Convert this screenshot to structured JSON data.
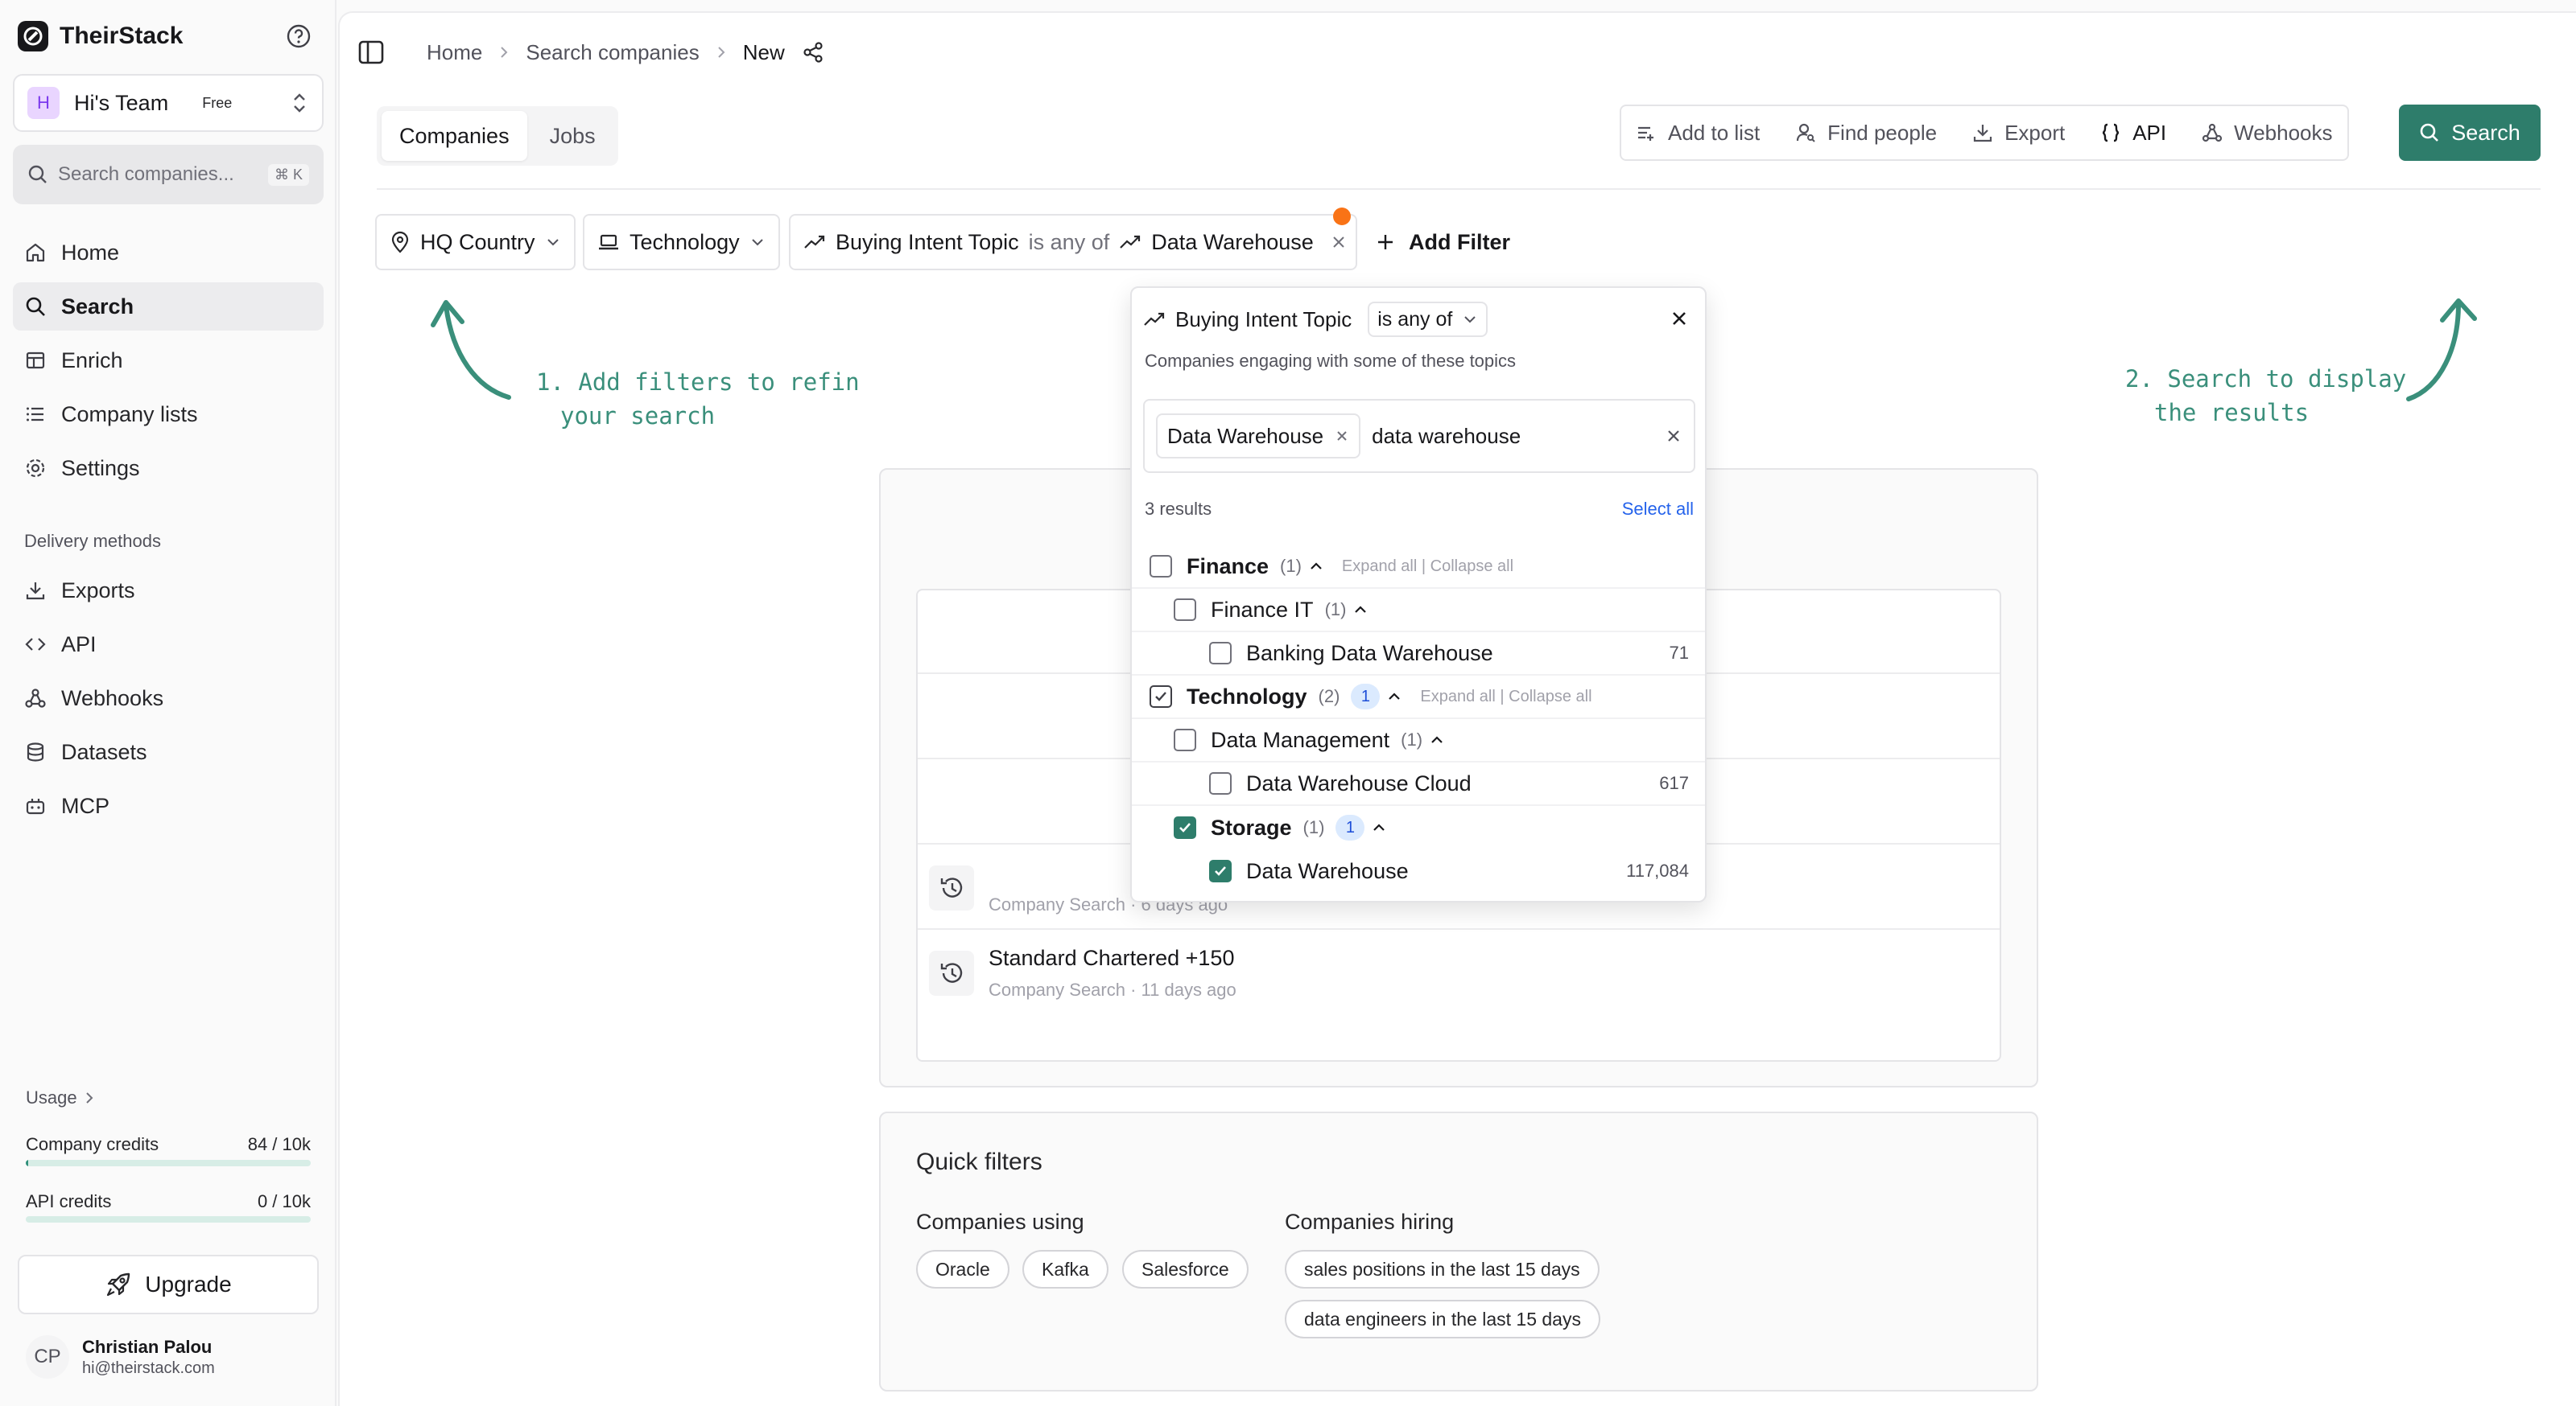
{
  "app": {
    "name": "TheirStack"
  },
  "team": {
    "avatar": "H",
    "name": "Hi's Team",
    "plan": "Free"
  },
  "sidebar": {
    "search_placeholder": "Search companies...",
    "search_shortcut": "⌘ K",
    "nav": [
      {
        "label": "Home",
        "icon": "home-icon"
      },
      {
        "label": "Search",
        "icon": "search-icon",
        "active": true
      },
      {
        "label": "Enrich",
        "icon": "enrich-icon"
      },
      {
        "label": "Company lists",
        "icon": "list-icon"
      },
      {
        "label": "Settings",
        "icon": "gear-icon"
      }
    ],
    "delivery_label": "Delivery methods",
    "delivery": [
      {
        "label": "Exports",
        "icon": "download-icon"
      },
      {
        "label": "API",
        "icon": "code-icon"
      },
      {
        "label": "Webhooks",
        "icon": "webhook-icon"
      },
      {
        "label": "Datasets",
        "icon": "database-icon"
      },
      {
        "label": "MCP",
        "icon": "mcp-icon"
      }
    ],
    "usage_label": "Usage",
    "credits": [
      {
        "label": "Company credits",
        "value": "84 / 10k",
        "fraction": 0.0084
      },
      {
        "label": "API credits",
        "value": "0 / 10k",
        "fraction": 0.0
      }
    ],
    "upgrade_label": "Upgrade",
    "user": {
      "initials": "CP",
      "name": "Christian Palou",
      "email": "hi@theirstack.com"
    }
  },
  "breadcrumb": {
    "items": [
      "Home",
      "Search companies"
    ],
    "current": "New"
  },
  "tabs": [
    {
      "label": "Companies",
      "active": true
    },
    {
      "label": "Jobs"
    }
  ],
  "actions": {
    "add_to_list": "Add to list",
    "find_people": "Find people",
    "export": "Export",
    "api": "API",
    "webhooks": "Webhooks",
    "search": "Search"
  },
  "filters": {
    "hq_country": "HQ Country",
    "technology": "Technology",
    "buying_intent": {
      "field": "Buying Intent Topic",
      "operator": "is any of",
      "value": "Data Warehouse"
    },
    "add_filter": "Add Filter"
  },
  "hints": {
    "left": [
      "1. Add filters to refin",
      "your search"
    ],
    "right": [
      "2. Search to display",
      "the results"
    ]
  },
  "popover": {
    "field": "Buying Intent Topic",
    "operator": "is any of",
    "description": "Companies engaging with some of these topics",
    "tag": "Data Warehouse",
    "query": "data warehouse",
    "results_count": "3 results",
    "select_all": "Select all",
    "expand_all": "Expand all",
    "collapse_all": "Collapse all",
    "tree": [
      {
        "label": "Finance",
        "count": "(1)",
        "level": 0,
        "checked": false
      },
      {
        "label": "Finance IT",
        "count": "(1)",
        "level": 1,
        "checked": false
      },
      {
        "label": "Banking Data Warehouse",
        "value": "71",
        "level": 2,
        "checked": false
      },
      {
        "label": "Technology",
        "count": "(2)",
        "badge": "1",
        "level": 0,
        "checked": "partial"
      },
      {
        "label": "Data Management",
        "count": "(1)",
        "level": 1,
        "checked": false
      },
      {
        "label": "Data Warehouse Cloud",
        "value": "617",
        "level": 2,
        "checked": false
      },
      {
        "label": "Storage",
        "count": "(1)",
        "badge": "1",
        "level": 1,
        "checked": true
      },
      {
        "label": "Data Warehouse",
        "value": "117,084",
        "level": 2,
        "checked": true
      }
    ]
  },
  "recent": [
    {
      "title": "",
      "subtitle": "Company Search · 6 days ago"
    },
    {
      "title": "Standard Chartered +150",
      "subtitle": "Company Search · 11 days ago"
    }
  ],
  "quick_filters": {
    "title": "Quick filters",
    "using_title": "Companies using",
    "using": [
      "Oracle",
      "Kafka",
      "Salesforce"
    ],
    "hiring_title": "Companies hiring",
    "hiring": [
      "sales positions in the last 15 days",
      "data engineers in the last 15 days"
    ]
  },
  "colors": {
    "accent": "#2e7d6b",
    "hint": "#3a8f7b",
    "notify": "#f97316",
    "link": "#2563eb"
  }
}
